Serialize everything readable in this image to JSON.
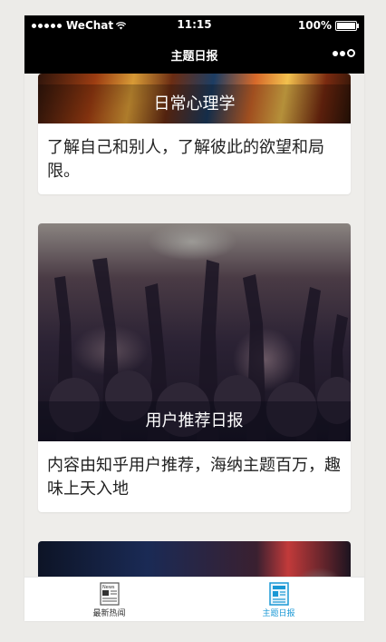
{
  "status_bar": {
    "carrier": "WeChat",
    "time": "11:15",
    "battery": "100%"
  },
  "nav": {
    "title": "主题日报"
  },
  "cards": [
    {
      "title": "日常心理学",
      "description": "了解自己和别人，了解彼此的欲望和局限。"
    },
    {
      "title": "用户推荐日报",
      "description": "内容由知乎用户推荐，海纳主题百万，趣味上天入地"
    }
  ],
  "tabs": [
    {
      "label": "最新热闻",
      "icon": "news-icon",
      "active": false
    },
    {
      "label": "主题日报",
      "icon": "daily-icon",
      "active": true
    }
  ],
  "colors": {
    "active_tab": "#1a98d5",
    "bar_bg": "#000000"
  }
}
